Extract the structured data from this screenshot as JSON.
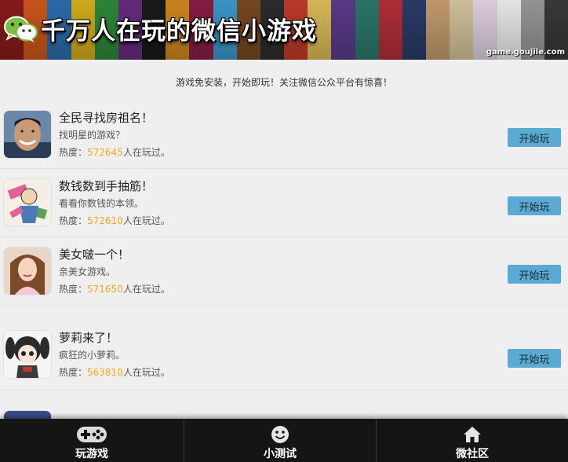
{
  "banner": {
    "title": "千万人在玩的微信小游戏",
    "domain": "game.goujile.com",
    "logo_icon": "wechat-icon",
    "stripe_colors": [
      "#8a1c1c",
      "#d1581b",
      "#2c6fb0",
      "#d8b21c",
      "#2f8a3c",
      "#6a2c82",
      "#1a1a1a",
      "#d38a1e",
      "#8b1d47",
      "#3e9bcf",
      "#7a4a20",
      "#2d2d2d",
      "#c43c2b",
      "#e0c05a",
      "#5b3b8c",
      "#2b7b6a",
      "#b52f3a",
      "#2a3d6a",
      "#c8a070",
      "#d8c8a0",
      "#e6d6e6",
      "#f0f0f0",
      "#9a9a9a",
      "#3a3a3a"
    ]
  },
  "notice": "游戏免安装，开始即玩！关注微信公众平台有惊喜！",
  "games": [
    {
      "title": "全民寻找房祖名！",
      "desc": "找明星的游戏？",
      "heat_label": "热度：",
      "heat_value": "572645",
      "heat_suffix": "人在玩过。",
      "button": "开始玩"
    },
    {
      "title": "数钱数到手抽筋！",
      "desc": "看看你数钱的本领。",
      "heat_label": "热度：",
      "heat_value": "572610",
      "heat_suffix": "人在玩过。",
      "button": "开始玩"
    },
    {
      "title": "美女啵一个！",
      "desc": "亲美女游戏。",
      "heat_label": "热度：",
      "heat_value": "571650",
      "heat_suffix": "人在玩过。",
      "button": "开始玩"
    },
    {
      "title": "萝莉来了！",
      "desc": "疯狂的小萝莉。",
      "heat_label": "热度：",
      "heat_value": "563810",
      "heat_suffix": "人在玩过。",
      "button": "开始玩"
    }
  ],
  "nav": [
    {
      "label": "玩游戏",
      "icon": "gamepad-icon"
    },
    {
      "label": "小测试",
      "icon": "smiley-icon"
    },
    {
      "label": "微社区",
      "icon": "home-icon"
    }
  ],
  "colors": {
    "accent_button": "#5aaad3",
    "heat_number": "#f5a623",
    "nav_background": "#151515"
  }
}
